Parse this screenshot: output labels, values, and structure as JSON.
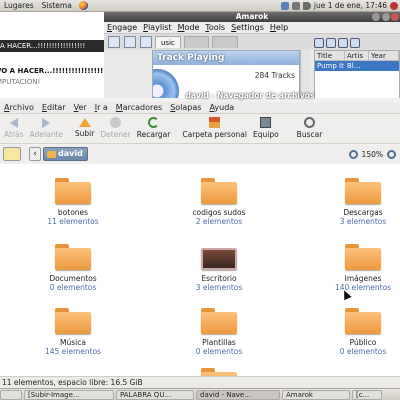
{
  "top_panel": {
    "menus": [
      "Lugares",
      "Sistema"
    ],
    "clock": "jue 1 de ene, 17:46"
  },
  "background_window": {
    "line1": "A HACER...!!!!!!!!!!!!!!!!!",
    "line2": "VO A HACER...!!!!!!!!!!!!!!!!!",
    "line3": "MPUTACION!"
  },
  "amarok": {
    "title": "Amarok",
    "menu": [
      "Engage",
      "Playlist",
      "Mode",
      "Tools",
      "Settings",
      "Help"
    ],
    "tabs": [
      "usic"
    ],
    "context_header": "Track Playing",
    "context_count": "284 Tracks",
    "playlist_headers": [
      "Title",
      "Artis",
      "Year"
    ],
    "playlist_row": [
      "Pump It",
      "Bl...",
      ""
    ]
  },
  "nautilus": {
    "title": "david - Navegador de archivos",
    "menu": [
      "Archivo",
      "Editar",
      "Ver",
      "Ir a",
      "Marcadores",
      "Solapas",
      "Ayuda"
    ],
    "toolbar": {
      "back": "Atrás",
      "forward": "Adelante",
      "up": "Subir",
      "stop": "Detener",
      "reload": "Recargar",
      "home": "Carpeta personal",
      "computer": "Equipo",
      "search": "Buscar"
    },
    "location": "david",
    "zoom": "150%",
    "items": [
      {
        "name": "botones",
        "count": "11 elementos"
      },
      {
        "name": "codigos sudos",
        "count": "2 elementos"
      },
      {
        "name": "Descargas",
        "count": "3 elementos"
      },
      {
        "name": "Documentos",
        "count": "0 elementos"
      },
      {
        "name": "Escritorio",
        "count": "3 elementos"
      },
      {
        "name": "Imágenes",
        "count": "140 elementos"
      },
      {
        "name": "Música",
        "count": "145 elementos"
      },
      {
        "name": "Plantillas",
        "count": "0 elementos"
      },
      {
        "name": "Público",
        "count": "0 elementos"
      }
    ],
    "status": "11 elementos, espacio libre: 16.5 GiB"
  },
  "taskbar": {
    "tasks": [
      "[Subir-Image...",
      "PALABRA QU...",
      "david - Nave...",
      "Amarok",
      "[c..."
    ]
  }
}
